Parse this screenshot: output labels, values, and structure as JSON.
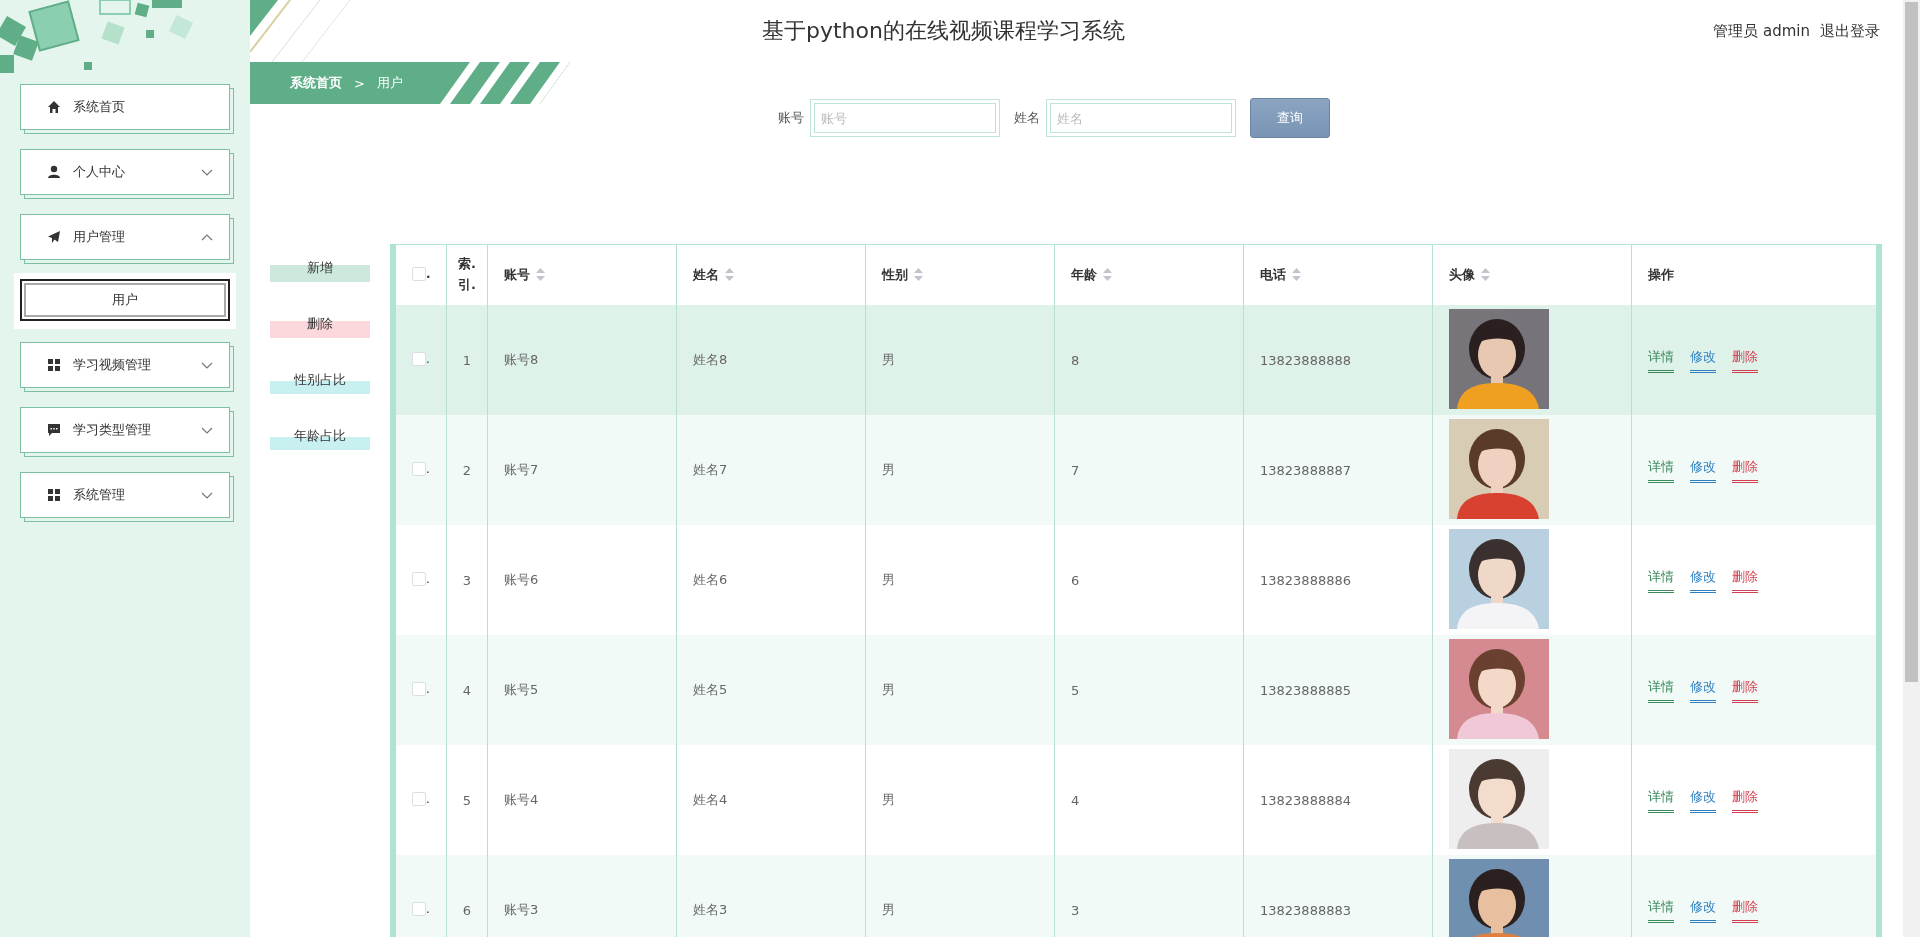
{
  "sidebar": {
    "menu": [
      {
        "kind": "home",
        "label": "系统首页"
      },
      {
        "kind": "user",
        "label": "个人中心",
        "expanded": false
      },
      {
        "kind": "send",
        "label": "用户管理",
        "expanded": true,
        "children": [
          {
            "label": "用户",
            "selected": true
          }
        ]
      },
      {
        "kind": "grid",
        "label": "学习视频管理",
        "expanded": false
      },
      {
        "kind": "chat",
        "label": "学习类型管理",
        "expanded": false
      },
      {
        "kind": "grid",
        "label": "系统管理",
        "expanded": false
      }
    ]
  },
  "header": {
    "title": "基于python的在线视频课程学习系统",
    "user": "管理员 admin",
    "logout": "退出登录"
  },
  "breadcrumb": [
    "系统首页",
    ">",
    "用户"
  ],
  "search": {
    "fields": [
      {
        "label": "账号",
        "placeholder": "账号"
      },
      {
        "label": "姓名",
        "placeholder": "姓名"
      }
    ],
    "button": "查询"
  },
  "actions": [
    {
      "label": "新增",
      "kind": "add"
    },
    {
      "label": "删除",
      "kind": "delete"
    },
    {
      "label": "性别占比",
      "kind": "chart"
    },
    {
      "label": "年龄占比",
      "kind": "chart"
    }
  ],
  "table": {
    "check_mark": ".",
    "header_checked": false,
    "columns": [
      {
        "label": "索.引.",
        "sortable": false
      },
      {
        "label": "账号",
        "sortable": true
      },
      {
        "label": "姓名",
        "sortable": true
      },
      {
        "label": "性别",
        "sortable": true
      },
      {
        "label": "年龄",
        "sortable": true
      },
      {
        "label": "电话",
        "sortable": true
      },
      {
        "label": "头像",
        "sortable": true
      },
      {
        "label": "操作",
        "sortable": false
      }
    ],
    "rows": [
      {
        "checked": false,
        "selected": true,
        "cells": [
          "1",
          "账号8",
          "姓名8",
          "男",
          "8",
          "13823888888"
        ],
        "avatar": {
          "kind": "picture"
        },
        "actions": [
          {
            "label": "详情",
            "kind": "detail"
          },
          {
            "label": "修改",
            "kind": "edit"
          },
          {
            "label": "删除",
            "kind": "delete"
          }
        ]
      },
      {
        "checked": false,
        "selected": false,
        "cells": [
          "2",
          "账号7",
          "姓名7",
          "男",
          "7",
          "13823888887"
        ],
        "avatar": {
          "kind": "picture"
        },
        "actions": [
          {
            "label": "详情",
            "kind": "detail"
          },
          {
            "label": "修改",
            "kind": "edit"
          },
          {
            "label": "删除",
            "kind": "delete"
          }
        ]
      },
      {
        "checked": false,
        "selected": false,
        "cells": [
          "3",
          "账号6",
          "姓名6",
          "男",
          "6",
          "13823888886"
        ],
        "avatar": {
          "kind": "picture"
        },
        "actions": [
          {
            "label": "详情",
            "kind": "detail"
          },
          {
            "label": "修改",
            "kind": "edit"
          },
          {
            "label": "删除",
            "kind": "delete"
          }
        ]
      },
      {
        "checked": false,
        "selected": false,
        "cells": [
          "4",
          "账号5",
          "姓名5",
          "男",
          "5",
          "13823888885"
        ],
        "avatar": {
          "kind": "picture"
        },
        "actions": [
          {
            "label": "详情",
            "kind": "detail"
          },
          {
            "label": "修改",
            "kind": "edit"
          },
          {
            "label": "删除",
            "kind": "delete"
          }
        ]
      },
      {
        "checked": false,
        "selected": false,
        "cells": [
          "5",
          "账号4",
          "姓名4",
          "男",
          "4",
          "13823888884"
        ],
        "avatar": {
          "kind": "picture"
        },
        "actions": [
          {
            "label": "详情",
            "kind": "detail"
          },
          {
            "label": "修改",
            "kind": "edit"
          },
          {
            "label": "删除",
            "kind": "delete"
          }
        ]
      },
      {
        "checked": false,
        "selected": false,
        "cells": [
          "6",
          "账号3",
          "姓名3",
          "男",
          "3",
          "13823888883"
        ],
        "avatar": {
          "kind": "picture"
        },
        "actions": [
          {
            "label": "详情",
            "kind": "detail"
          },
          {
            "label": "修改",
            "kind": "edit"
          },
          {
            "label": "删除",
            "kind": "delete"
          }
        ]
      }
    ]
  }
}
